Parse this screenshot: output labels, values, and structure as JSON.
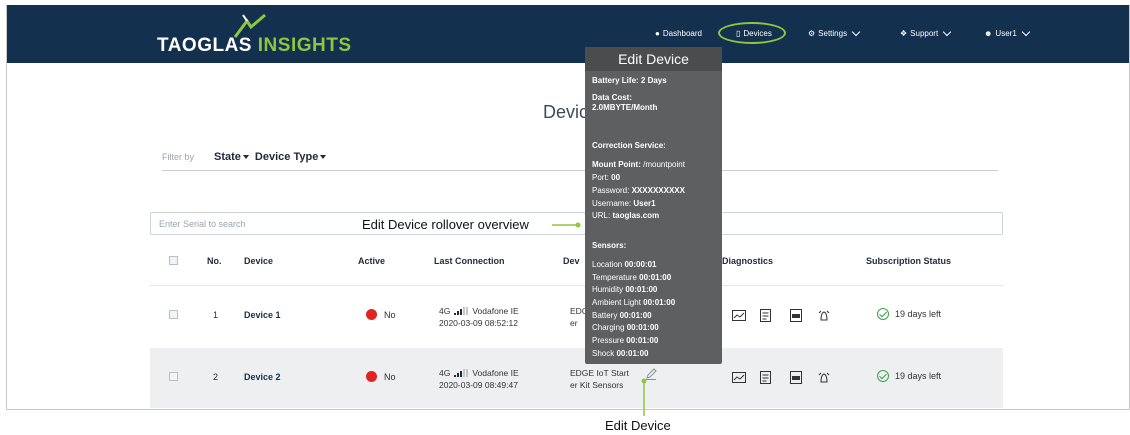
{
  "header": {
    "logo_main": "TAOGLAS",
    "logo_sub": "INSIGHTS",
    "nav": [
      {
        "label": "Dashboard",
        "icon": "dashboard-icon"
      },
      {
        "label": "Devices",
        "icon": "device-icon"
      },
      {
        "label": "Settings",
        "icon": "gear-icon"
      },
      {
        "label": "Support",
        "icon": "help-icon"
      },
      {
        "label": "User1",
        "icon": "user-icon"
      }
    ]
  },
  "page": {
    "title": "Devices"
  },
  "filter": {
    "label": "Filter by",
    "state": "State",
    "device_type": "Device Type"
  },
  "search": {
    "placeholder": "Enter Serial to search"
  },
  "table": {
    "headers": [
      "No.",
      "Device",
      "Active",
      "Last Connection",
      "Dev",
      "Diagnostics",
      "Subscription Status"
    ],
    "rows": [
      {
        "no": "1",
        "device": "Device 1",
        "active": "No",
        "network": "4G",
        "carrier": "Vodafone IE",
        "time": "2020-03-09 08:52:12",
        "type_a": "EDG",
        "type_b": "er",
        "subscription": "19 days left"
      },
      {
        "no": "2",
        "device": "Device 2",
        "active": "No",
        "network": "4G",
        "carrier": "Vodafone IE",
        "time": "2020-03-09 08:49:47",
        "type_a": "EDGE IoT Start",
        "type_b": "er Kit Sensors",
        "subscription": "19 days left"
      }
    ]
  },
  "tooltip": {
    "title": "Edit Device",
    "battery": "Battery Life: 2 Days",
    "data_cost_label": "Data Cost:",
    "data_cost_value": "2.0MBYTE/Month",
    "correction": "Correction Service:",
    "mount_label": "Mount Point:",
    "mount_value": "/mountpoint",
    "port_label": "Port:",
    "port_value": "00",
    "password_label": "Password:",
    "password_value": "XXXXXXXXXX",
    "username_label": "Username:",
    "username_value": "User1",
    "url_label": "URL:",
    "url_value": "taoglas.com",
    "sensors": "Sensors:",
    "sensor_list": [
      {
        "name": "Location",
        "value": "00:00:01"
      },
      {
        "name": "Temperature",
        "value": "00:01:00"
      },
      {
        "name": "Humidity",
        "value": "00:01:00"
      },
      {
        "name": "Ambient Light",
        "value": "00:01:00"
      },
      {
        "name": "Battery",
        "value": "00:01:00"
      },
      {
        "name": "Charging",
        "value": "00:01:00"
      },
      {
        "name": "Pressure",
        "value": "00:01:00"
      },
      {
        "name": "Shock",
        "value": "00:01:00"
      }
    ]
  },
  "annotations": {
    "rollover": "Edit Device rollover overview",
    "edit": "Edit Device"
  },
  "colors": {
    "header_bg": "#14304f",
    "accent": "#8ec63f",
    "inactive": "#e02424",
    "ok": "#3aa34a"
  }
}
